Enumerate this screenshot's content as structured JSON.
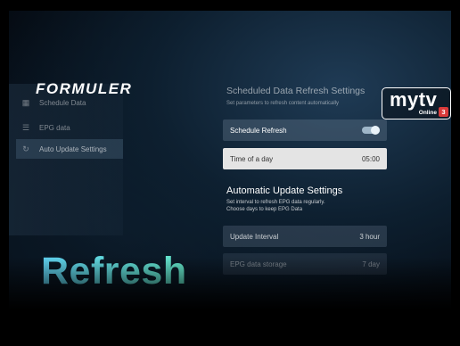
{
  "brand": {
    "logo": "FORMULER"
  },
  "sidebar": {
    "items": [
      {
        "label": "Schedule Data",
        "icon": "calendar-icon",
        "active": false
      },
      {
        "label": "EPG data",
        "icon": "grid-icon",
        "active": false
      },
      {
        "label": "Auto Update Settings",
        "icon": "refresh-icon",
        "active": true
      }
    ]
  },
  "scheduled": {
    "title": "Scheduled Data Refresh Settings",
    "subtitle": "Set parameters to refresh content automatically",
    "schedule_refresh": {
      "label": "Schedule Refresh",
      "enabled": true
    },
    "time_of_day": {
      "label": "Time of a day",
      "value": "05:00"
    }
  },
  "automatic": {
    "title": "Automatic Update Settings",
    "subtitle_line1": "Set interval to refresh EPG data regularly.",
    "subtitle_line2": "Choose days to keep EPG Data",
    "update_interval": {
      "label": "Update Interval",
      "value": "3 hour"
    },
    "epg_storage": {
      "label": "EPG data storage",
      "value": "7 day"
    }
  },
  "mytv": {
    "word": "mytv",
    "online": "Online",
    "version": "3"
  },
  "overlay": {
    "headline": "Refresh"
  },
  "colors": {
    "accent": "#5fd0f0",
    "badge": "#d93a3a",
    "selected_row": "#e4e4e4"
  }
}
